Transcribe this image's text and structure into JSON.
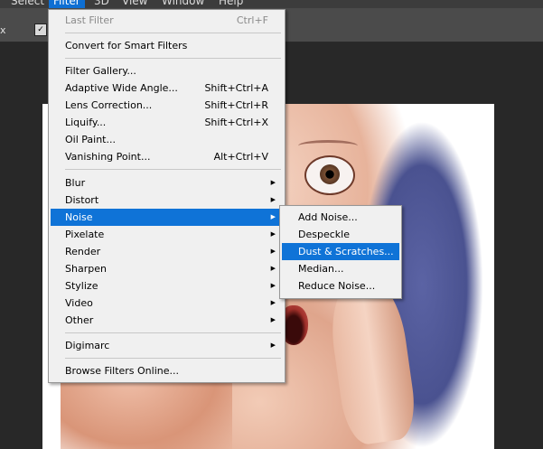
{
  "menubar": {
    "items": [
      {
        "label": "Select"
      },
      {
        "label": "Filter"
      },
      {
        "label": "3D"
      },
      {
        "label": "View"
      },
      {
        "label": "Window"
      },
      {
        "label": "Help"
      }
    ]
  },
  "options_bar": {
    "fragment": "x"
  },
  "filter_menu": {
    "items": [
      {
        "label": "Last Filter",
        "shortcut": "Ctrl+F"
      },
      {
        "label": "Convert for Smart Filters"
      },
      {
        "label": "Filter Gallery..."
      },
      {
        "label": "Adaptive Wide Angle...",
        "shortcut": "Shift+Ctrl+A"
      },
      {
        "label": "Lens Correction...",
        "shortcut": "Shift+Ctrl+R"
      },
      {
        "label": "Liquify...",
        "shortcut": "Shift+Ctrl+X"
      },
      {
        "label": "Oil Paint..."
      },
      {
        "label": "Vanishing Point...",
        "shortcut": "Alt+Ctrl+V"
      },
      {
        "label": "Blur"
      },
      {
        "label": "Distort"
      },
      {
        "label": "Noise"
      },
      {
        "label": "Pixelate"
      },
      {
        "label": "Render"
      },
      {
        "label": "Sharpen"
      },
      {
        "label": "Stylize"
      },
      {
        "label": "Video"
      },
      {
        "label": "Other"
      },
      {
        "label": "Digimarc"
      },
      {
        "label": "Browse Filters Online..."
      }
    ]
  },
  "noise_submenu": {
    "items": [
      {
        "label": "Add Noise..."
      },
      {
        "label": "Despeckle"
      },
      {
        "label": "Dust & Scratches..."
      },
      {
        "label": "Median..."
      },
      {
        "label": "Reduce Noise..."
      }
    ]
  },
  "colors": {
    "highlight": "#0f73d7",
    "menu_bg": "#f0f0f0",
    "workspace": "#282828"
  }
}
